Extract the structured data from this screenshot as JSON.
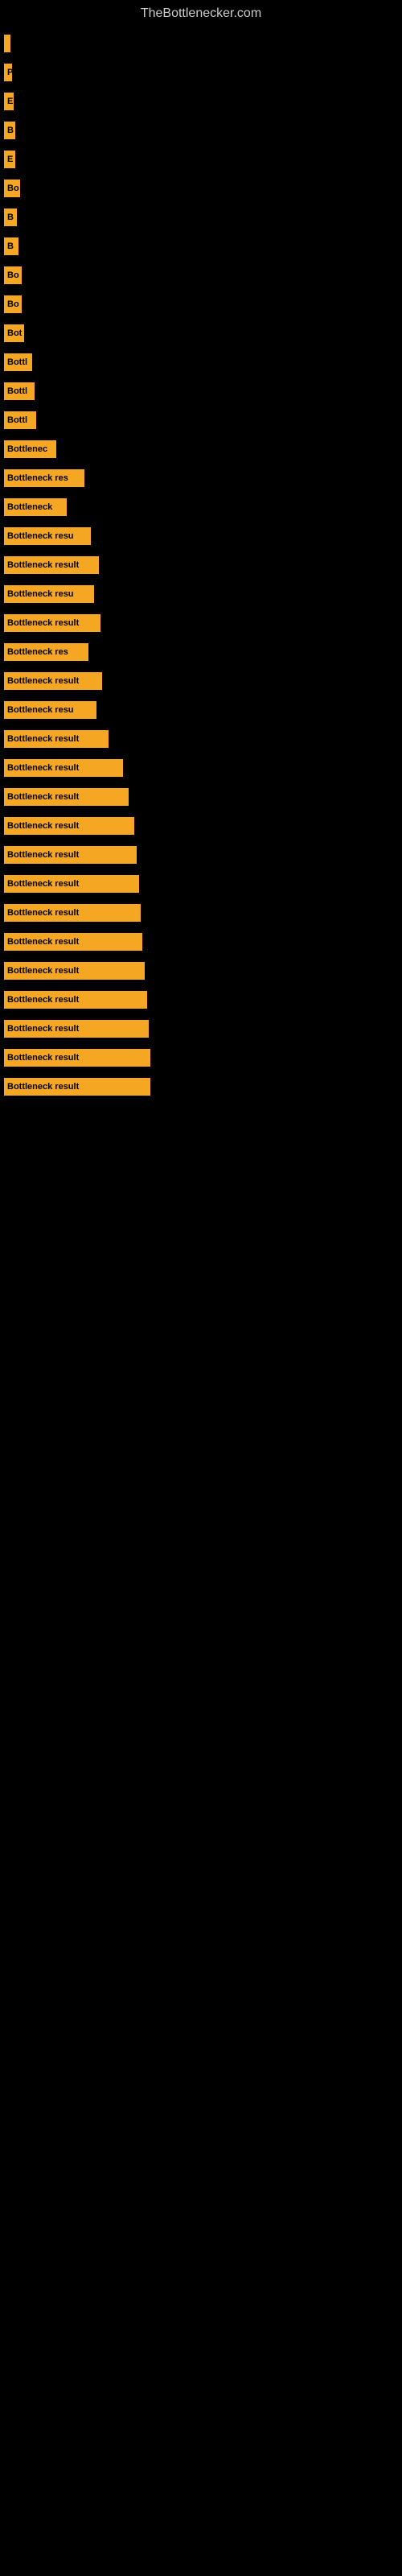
{
  "site": {
    "title": "TheBottlenecker.com"
  },
  "bars": [
    {
      "id": 1,
      "label": "",
      "width": 8,
      "text": ""
    },
    {
      "id": 2,
      "label": "P",
      "width": 10,
      "text": "P"
    },
    {
      "id": 3,
      "label": "E",
      "width": 12,
      "text": "E"
    },
    {
      "id": 4,
      "label": "B",
      "width": 14,
      "text": "B"
    },
    {
      "id": 5,
      "label": "E",
      "width": 14,
      "text": "E"
    },
    {
      "id": 6,
      "label": "Bo",
      "width": 20,
      "text": "Bo"
    },
    {
      "id": 7,
      "label": "B",
      "width": 16,
      "text": "B"
    },
    {
      "id": 8,
      "label": "B",
      "width": 18,
      "text": "B"
    },
    {
      "id": 9,
      "label": "Bo",
      "width": 22,
      "text": "Bo"
    },
    {
      "id": 10,
      "label": "Bo",
      "width": 22,
      "text": "Bo"
    },
    {
      "id": 11,
      "label": "Bot",
      "width": 25,
      "text": "Bot"
    },
    {
      "id": 12,
      "label": "Bottl",
      "width": 35,
      "text": "Bottl"
    },
    {
      "id": 13,
      "label": "Bottl",
      "width": 38,
      "text": "Bottl"
    },
    {
      "id": 14,
      "label": "Bottl",
      "width": 40,
      "text": "Bottl"
    },
    {
      "id": 15,
      "label": "Bottlenec",
      "width": 65,
      "text": "Bottlenec"
    },
    {
      "id": 16,
      "label": "Bottleneck res",
      "width": 100,
      "text": "Bottleneck res"
    },
    {
      "id": 17,
      "label": "Bottleneck",
      "width": 78,
      "text": "Bottleneck"
    },
    {
      "id": 18,
      "label": "Bottleneck resu",
      "width": 108,
      "text": "Bottleneck resu"
    },
    {
      "id": 19,
      "label": "Bottleneck result",
      "width": 118,
      "text": "Bottleneck result"
    },
    {
      "id": 20,
      "label": "Bottleneck resu",
      "width": 112,
      "text": "Bottleneck resu"
    },
    {
      "id": 21,
      "label": "Bottleneck result",
      "width": 120,
      "text": "Bottleneck result"
    },
    {
      "id": 22,
      "label": "Bottleneck res",
      "width": 105,
      "text": "Bottleneck res"
    },
    {
      "id": 23,
      "label": "Bottleneck result",
      "width": 122,
      "text": "Bottleneck result"
    },
    {
      "id": 24,
      "label": "Bottleneck resu",
      "width": 115,
      "text": "Bottleneck resu"
    },
    {
      "id": 25,
      "label": "Bottleneck result",
      "width": 130,
      "text": "Bottleneck result"
    },
    {
      "id": 26,
      "label": "Bottleneck result",
      "width": 148,
      "text": "Bottleneck result"
    },
    {
      "id": 27,
      "label": "Bottleneck result",
      "width": 155,
      "text": "Bottleneck result"
    },
    {
      "id": 28,
      "label": "Bottleneck result",
      "width": 162,
      "text": "Bottleneck result"
    },
    {
      "id": 29,
      "label": "Bottleneck result",
      "width": 165,
      "text": "Bottleneck result"
    },
    {
      "id": 30,
      "label": "Bottleneck result",
      "width": 168,
      "text": "Bottleneck result"
    },
    {
      "id": 31,
      "label": "Bottleneck result",
      "width": 170,
      "text": "Bottleneck result"
    },
    {
      "id": 32,
      "label": "Bottleneck result",
      "width": 172,
      "text": "Bottleneck result"
    },
    {
      "id": 33,
      "label": "Bottleneck result",
      "width": 175,
      "text": "Bottleneck result"
    },
    {
      "id": 34,
      "label": "Bottleneck result",
      "width": 178,
      "text": "Bottleneck result"
    },
    {
      "id": 35,
      "label": "Bottleneck result",
      "width": 180,
      "text": "Bottleneck result"
    },
    {
      "id": 36,
      "label": "Bottleneck result",
      "width": 182,
      "text": "Bottleneck result"
    },
    {
      "id": 37,
      "label": "Bottleneck result",
      "width": 182,
      "text": "Bottleneck result"
    }
  ]
}
